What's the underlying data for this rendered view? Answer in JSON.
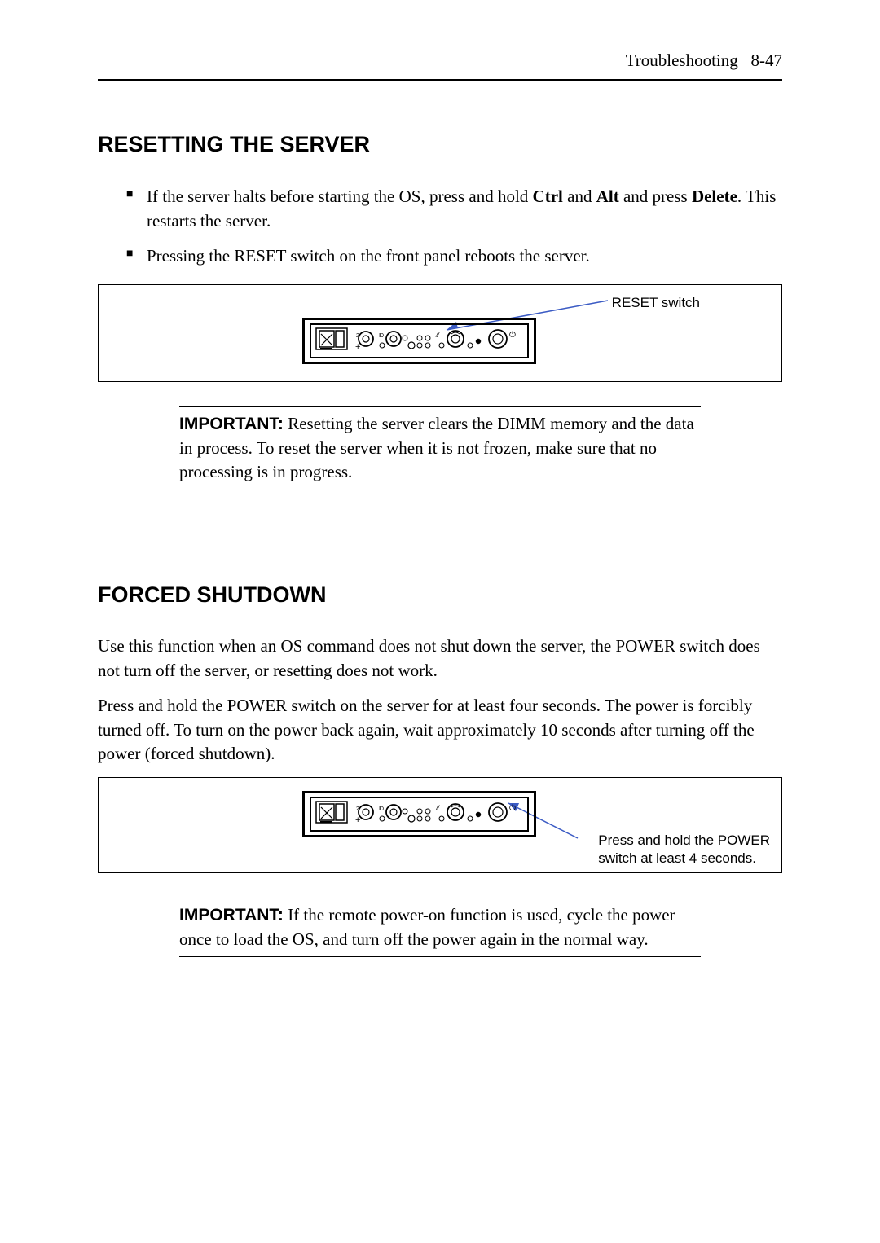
{
  "header": {
    "section": "Troubleshooting",
    "page": "8-47"
  },
  "section1": {
    "heading": "RESETTING THE SERVER",
    "bullets": {
      "b1_pre": "If the server halts before starting the OS, press and hold ",
      "b1_k1": "Ctrl",
      "b1_mid1": " and ",
      "b1_k2": "Alt",
      "b1_mid2": " and press ",
      "b1_k3": "Delete",
      "b1_post": ". This restarts the server.",
      "b2": "Pressing the RESET switch on the front panel reboots the server."
    },
    "figure": {
      "reset_label": "RESET switch"
    },
    "important": {
      "label": "IMPORTANT:",
      "text": " Resetting the server clears the DIMM memory and the data in process.   To reset the server when it is not frozen, make sure that no processing is in progress."
    }
  },
  "section2": {
    "heading": "FORCED SHUTDOWN",
    "para1": "Use this function when an OS command does not shut down the server, the POWER switch does not turn off the server, or resetting does not work.",
    "para2": "Press and hold the POWER switch on the server for at least four seconds.   The power is forcibly turned off.   To turn on the power back again, wait approximately 10 seconds after turning off the power (forced shutdown).",
    "figure": {
      "caption_l1": "Press and hold the POWER",
      "caption_l2": "switch at least 4 seconds."
    },
    "important": {
      "label": "IMPORTANT:",
      "text": " If the remote power-on function is used, cycle the power once to load the OS, and turn off the power again in the normal way."
    }
  }
}
